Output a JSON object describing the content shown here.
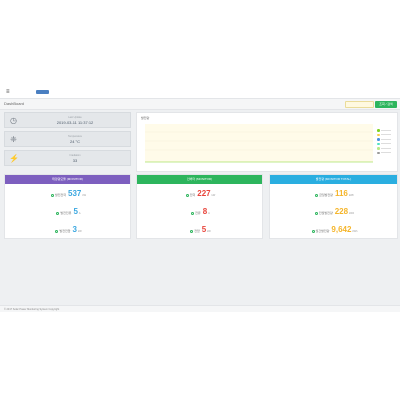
{
  "topbar": {
    "menu_icon": "≡"
  },
  "header": {
    "title": "DashBoard",
    "search_label": "조회 / 검색"
  },
  "info": [
    {
      "icon": "clock-icon",
      "label": "Last Update",
      "value": "2019-03-11 11:37:12"
    },
    {
      "icon": "thermometer-icon",
      "label": "Temperature",
      "value": "24 °C"
    },
    {
      "icon": "lightning-icon",
      "label": "Irradiation",
      "value": "33"
    }
  ],
  "chart_data": {
    "type": "line",
    "title": "발전량",
    "series": [
      {
        "name": "",
        "color": "#7ed321",
        "values": []
      },
      {
        "name": "",
        "color": "#f5d14a",
        "values": []
      },
      {
        "name": "",
        "color": "#4a90e2",
        "values": []
      },
      {
        "name": "",
        "color": "#50e3c2",
        "values": []
      },
      {
        "name": "",
        "color": "#b8e986",
        "values": []
      },
      {
        "name": "",
        "color": "#9b9b9b",
        "values": []
      }
    ],
    "legend": "right"
  },
  "panels": [
    {
      "header": "태양광모듈 (MONITOR)",
      "color": "#7d5fbf",
      "rows": [
        {
          "label": "발전전력",
          "value": "537",
          "unit": "kW",
          "color": "#3aa7e0"
        },
        {
          "label": "발전전류",
          "value": "5",
          "unit": "A",
          "color": "#3aa7e0"
        },
        {
          "label": "발전전압",
          "value": "3",
          "unit": "kW",
          "color": "#3aa7e0"
        }
      ]
    },
    {
      "header": "인버터 (MONITOR)",
      "color": "#2db55d",
      "rows": [
        {
          "label": "전력",
          "value": "227",
          "unit": "kW",
          "color": "#e8453c"
        },
        {
          "label": "전류",
          "value": "8",
          "unit": "A",
          "color": "#e8453c"
        },
        {
          "label": "전압",
          "value": "5",
          "unit": "kW",
          "color": "#e8453c"
        }
      ]
    },
    {
      "header": "발전량 (MONITOR TOTAL)",
      "color": "#2aaee0",
      "rows": [
        {
          "label": "금일발전량",
          "value": "116",
          "unit": "kWh",
          "color": "#f5b52a"
        },
        {
          "label": "전월발전량",
          "value": "228",
          "unit": "kWh",
          "color": "#f5b52a"
        },
        {
          "label": "월간발전량",
          "value": "9,642",
          "unit": "kWh",
          "color": "#f5b52a"
        }
      ]
    }
  ],
  "footer": {
    "text": "© 2017 Solar Power Monitoring System Copyright"
  }
}
